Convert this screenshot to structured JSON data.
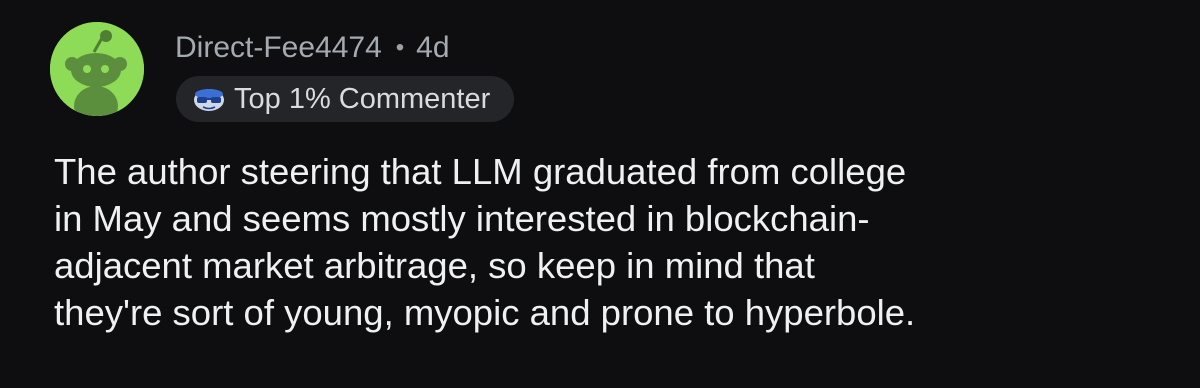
{
  "comment": {
    "author": {
      "username": "Direct-Fee4474",
      "avatar_icon": "snoo-avatar-icon",
      "avatar_color": "#8edb57"
    },
    "separator": "•",
    "age": "4d",
    "flair": {
      "icon": "sunglasses-snoo-icon",
      "label": "Top 1% Commenter"
    },
    "body_lines": [
      "The author steering that LLM graduated from college",
      "in May and seems mostly interested in blockchain-",
      "adjacent market arbitrage, so keep in mind that",
      "they're sort of young, myopic and prone to hyperbole."
    ]
  },
  "colors": {
    "background": "#0e0e10",
    "meta_text": "#a3aab0",
    "body_text": "#eef0f2",
    "flair_background": "#232528"
  }
}
